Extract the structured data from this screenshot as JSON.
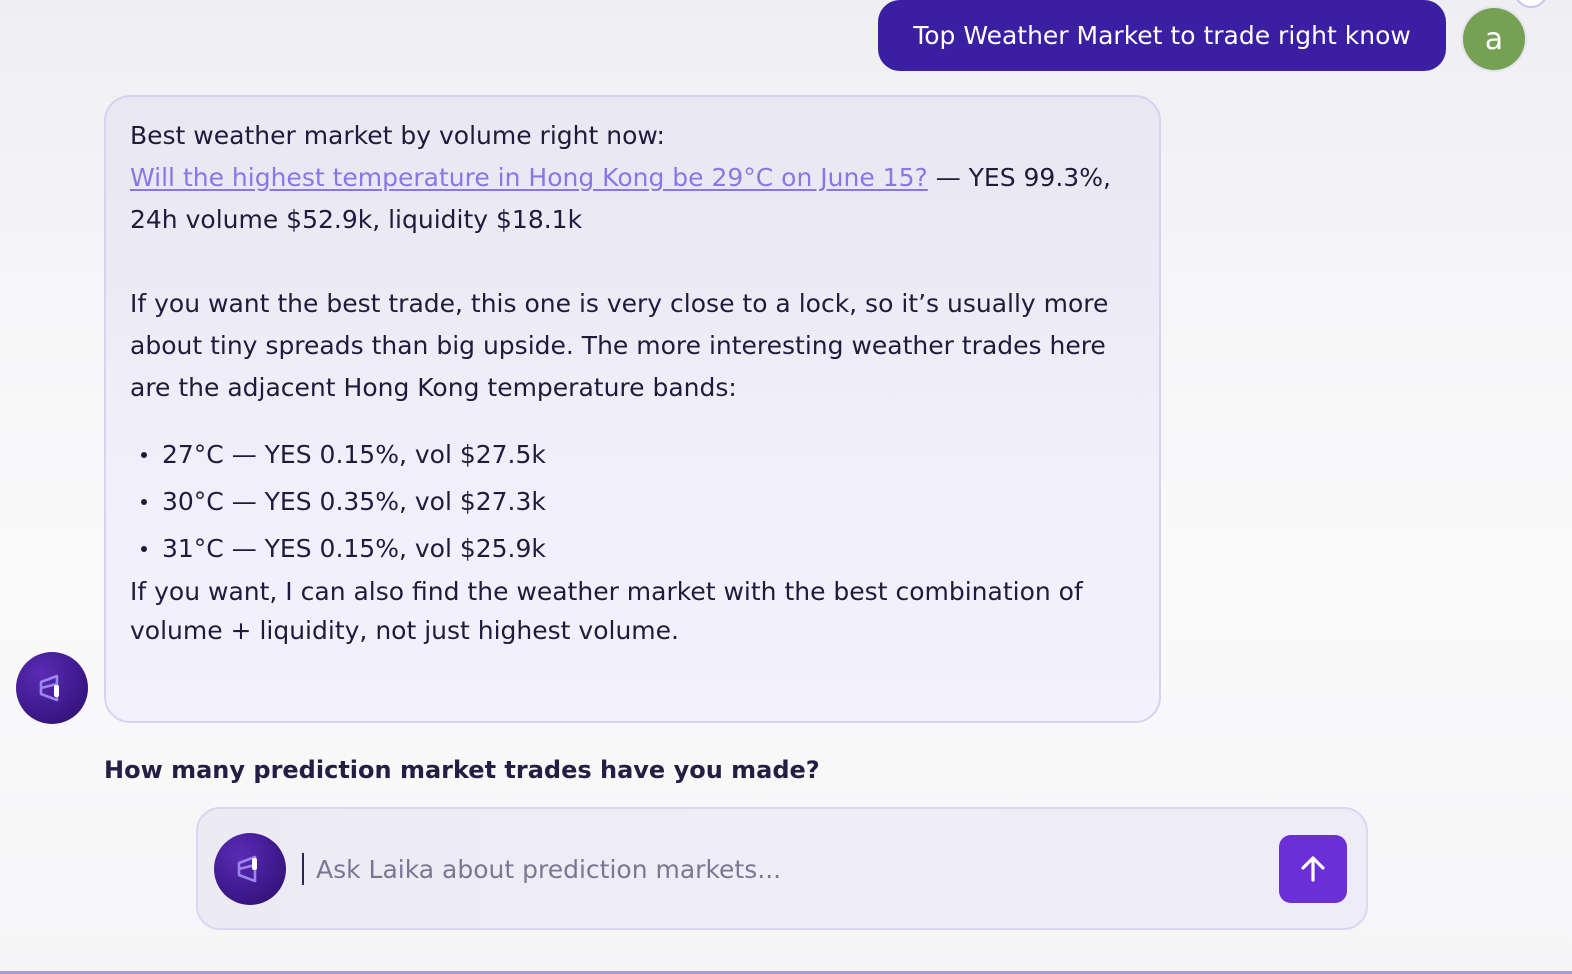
{
  "user_message": {
    "text": "Top Weather Market to trade right know",
    "avatar_letter": "a"
  },
  "bot_message": {
    "intro": "Best weather market by volume right now:",
    "market_link": "Will the highest temperature in Hong Kong be 29°C on June 15?",
    "market_stats": " — YES 99.3%, 24h volume $52.9k, liquidity $18.1k",
    "analysis": "If you want the best trade, this one is very close to a lock, so it’s usually more about tiny spreads than big upside. The more interesting weather trades here are the adjacent Hong Kong temperature bands:",
    "bands": [
      "27°C — YES 0.15%, vol $27.5k",
      "30°C — YES 0.35%, vol $27.3k",
      "31°C — YES 0.15%, vol $25.9k"
    ],
    "follow_up": "If you want, I can also find the weather market with the best combination of volume + liquidity, not just highest volume."
  },
  "suggested_question": "How many prediction market trades have you made?",
  "composer": {
    "placeholder": "Ask Laika about prediction markets...",
    "value": "",
    "send_icon": "arrow-up-icon"
  },
  "colors": {
    "user_bubble": "#3a1fa3",
    "user_avatar": "#76a052",
    "link": "#8a76e6",
    "send_button": "#6a2fd6",
    "logo": "#3f1a8e"
  }
}
